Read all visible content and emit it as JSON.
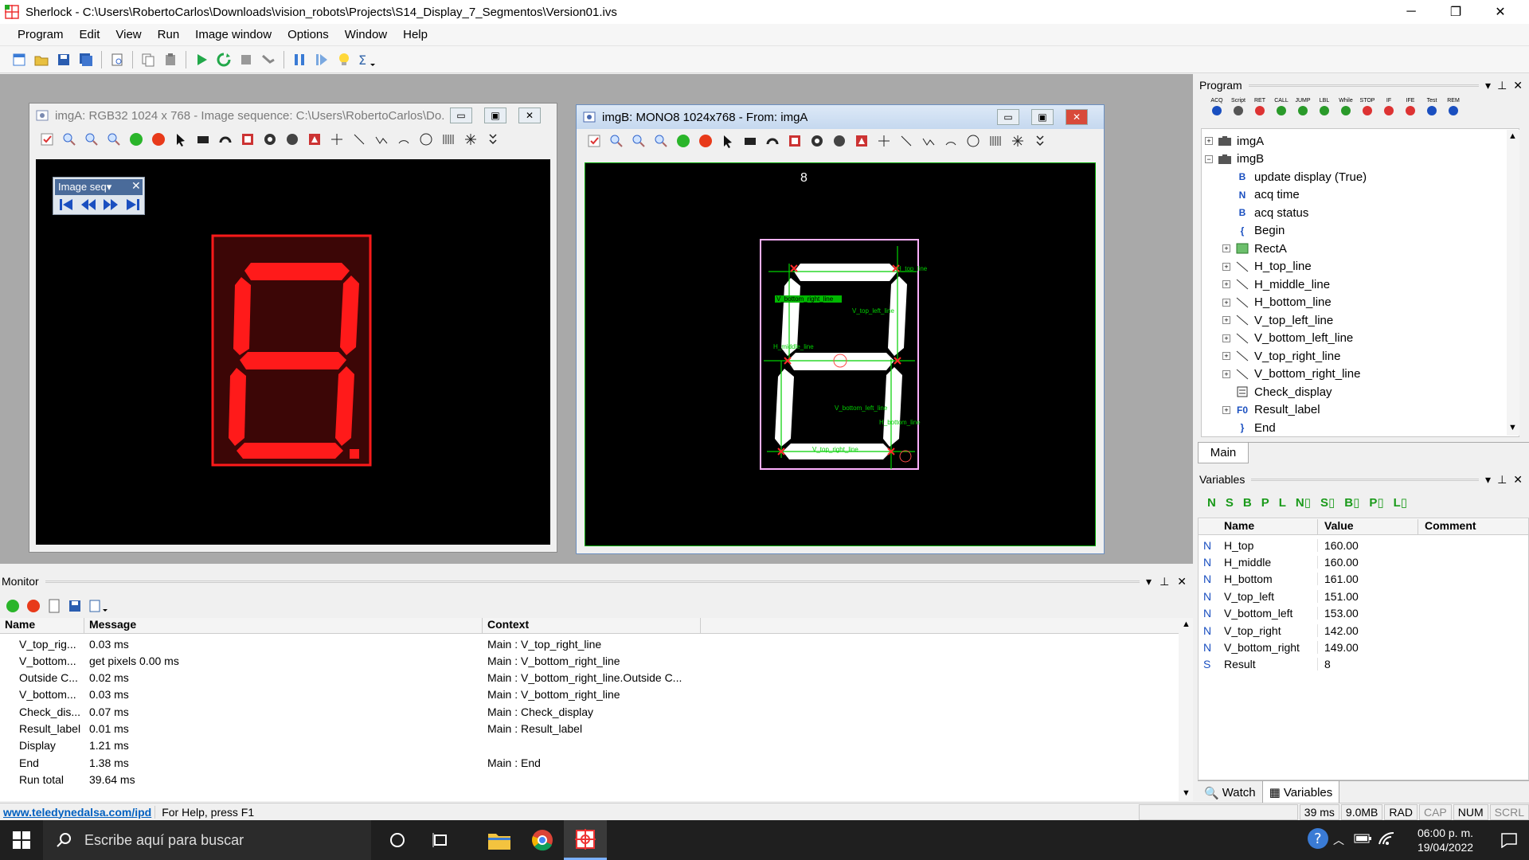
{
  "window": {
    "title": "Sherlock - C:\\Users\\RobertoCarlos\\Downloads\\vision_robots\\Projects\\S14_Display_7_Segmentos\\Version01.ivs",
    "minimize": "─",
    "restore": "❐",
    "close": "✕"
  },
  "menu": [
    "Program",
    "Edit",
    "View",
    "Run",
    "Image window",
    "Options",
    "Window",
    "Help"
  ],
  "imgA": {
    "caption": "imgA: RGB32 1024 x 768 - Image sequence: C:\\Users\\RobertoCarlos\\Do...",
    "seq_label": "Image seq▾"
  },
  "imgB": {
    "caption": "imgB: MONO8 1024x768 - From: imgA",
    "overlay_value": "8",
    "labels": {
      "h_top": "H_top_line",
      "v_top_left": "V_top_left_line",
      "v_bottom_right": "V_bottom_right_line",
      "h_middle": "H_middle_line",
      "v_bottom_left": "V_bottom_left_line",
      "h_bottom": "H_bottom_line",
      "v_top_right": "V_top_right_line"
    }
  },
  "program": {
    "title": "Program",
    "tab": "Main",
    "toolbar": [
      "ACQ",
      "Script",
      "RET",
      "CALL",
      "JUMP",
      "LBL",
      "While",
      "STOP",
      "IF",
      "IFE",
      "Test",
      "REM"
    ],
    "tree": [
      {
        "label": "imgA",
        "level": 0,
        "expander": "+",
        "icon": "camera-icon"
      },
      {
        "label": "imgB",
        "level": 0,
        "expander": "−",
        "icon": "camera-icon"
      },
      {
        "label": "update display (True)",
        "level": 1,
        "expander": "",
        "icon": "boolean-icon",
        "icon_text": "B"
      },
      {
        "label": "acq time",
        "level": 1,
        "expander": "",
        "icon": "number-icon",
        "icon_text": "N"
      },
      {
        "label": "acq status",
        "level": 1,
        "expander": "",
        "icon": "boolean-icon",
        "icon_text": "B"
      },
      {
        "label": "Begin",
        "level": 1,
        "expander": "",
        "icon": "brace-open-icon",
        "icon_text": "{"
      },
      {
        "label": "RectA",
        "level": 1,
        "expander": "+",
        "icon": "rect-roi-icon"
      },
      {
        "label": "H_top_line",
        "level": 1,
        "expander": "+",
        "icon": "line-roi-icon"
      },
      {
        "label": "H_middle_line",
        "level": 1,
        "expander": "+",
        "icon": "line-roi-icon"
      },
      {
        "label": "H_bottom_line",
        "level": 1,
        "expander": "+",
        "icon": "line-roi-icon"
      },
      {
        "label": "V_top_left_line",
        "level": 1,
        "expander": "+",
        "icon": "line-roi-icon"
      },
      {
        "label": "V_bottom_left_line",
        "level": 1,
        "expander": "+",
        "icon": "line-roi-icon"
      },
      {
        "label": "V_top_right_line",
        "level": 1,
        "expander": "+",
        "icon": "line-roi-icon"
      },
      {
        "label": "V_bottom_right_line",
        "level": 1,
        "expander": "+",
        "icon": "line-roi-icon"
      },
      {
        "label": "Check_display",
        "level": 1,
        "expander": "",
        "icon": "script-icon"
      },
      {
        "label": "Result_label",
        "level": 1,
        "expander": "+",
        "icon": "function-icon",
        "icon_text": "F0"
      },
      {
        "label": "End",
        "level": 1,
        "expander": "",
        "icon": "brace-close-icon",
        "icon_text": "}"
      }
    ]
  },
  "variables": {
    "title": "Variables",
    "filters": [
      "N",
      "S",
      "B",
      "P",
      "L",
      "N▯",
      "S▯",
      "B▯",
      "P▯",
      "L▯"
    ],
    "columns": [
      "Name",
      "Value",
      "Comment"
    ],
    "rows": [
      {
        "type": "N",
        "name": "H_top",
        "value": "160.00"
      },
      {
        "type": "N",
        "name": "H_middle",
        "value": "160.00"
      },
      {
        "type": "N",
        "name": "H_bottom",
        "value": "161.00"
      },
      {
        "type": "N",
        "name": "V_top_left",
        "value": "151.00"
      },
      {
        "type": "N",
        "name": "V_bottom_left",
        "value": "153.00"
      },
      {
        "type": "N",
        "name": "V_top_right",
        "value": "142.00"
      },
      {
        "type": "N",
        "name": "V_bottom_right",
        "value": "149.00"
      },
      {
        "type": "S",
        "name": "Result",
        "value": "8"
      }
    ],
    "tabs": [
      "Watch",
      "Variables"
    ]
  },
  "monitor": {
    "title": "Monitor",
    "columns": [
      "Name",
      "Message",
      "Context"
    ],
    "rows": [
      {
        "name": "V_top_rig...",
        "message": "0.03 ms",
        "context": "Main : V_top_right_line"
      },
      {
        "name": "V_bottom...",
        "message": "get pixels 0.00 ms",
        "context": "Main : V_bottom_right_line"
      },
      {
        "name": "Outside C...",
        "message": "0.02 ms",
        "context": "Main : V_bottom_right_line.Outside C..."
      },
      {
        "name": "V_bottom...",
        "message": "0.03 ms",
        "context": "Main : V_bottom_right_line"
      },
      {
        "name": "Check_dis...",
        "message": "0.07 ms",
        "context": "Main : Check_display"
      },
      {
        "name": "Result_label",
        "message": "0.01 ms",
        "context": "Main : Result_label"
      },
      {
        "name": "Display",
        "message": "1.21 ms",
        "context": ""
      },
      {
        "name": "End",
        "message": "1.38 ms",
        "context": "Main : End"
      },
      {
        "name": "Run total",
        "message": "39.64 ms",
        "context": ""
      }
    ]
  },
  "status": {
    "link": "www.teledynedalsa.com/ipd",
    "help": "For Help, press F1",
    "time": "39 ms",
    "mem": "9.0MB",
    "rad": "RAD",
    "cap": "CAP",
    "num": "NUM",
    "scrl": "SCRL"
  },
  "taskbar": {
    "search_placeholder": "Escribe aquí para buscar",
    "time": "06:00 p. m.",
    "date": "19/04/2022"
  },
  "colors": {
    "segment_on": "#ff1a1a",
    "segment_off": "#5a0a0a",
    "overlay_green": "#00d000",
    "accent_blue": "#0060c0"
  }
}
